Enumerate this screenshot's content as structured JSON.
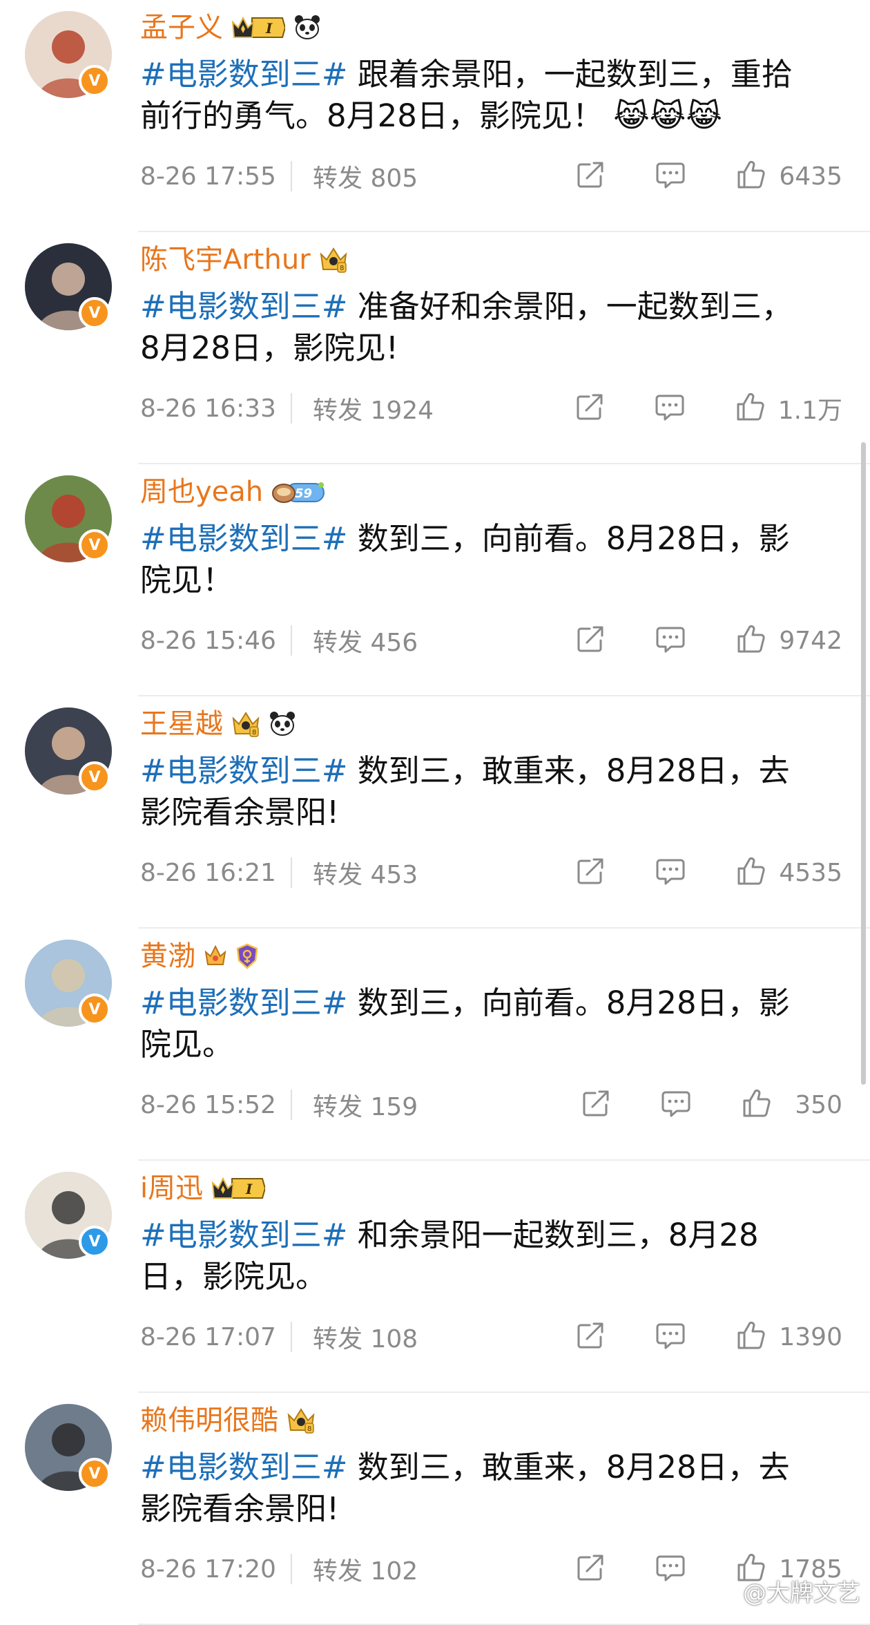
{
  "posts": [
    {
      "name": "孟子义",
      "verify": "orange",
      "medals": [
        "crown-level-1-badge",
        "panda-icon"
      ],
      "hashtag": "#电影数到三#",
      "text_line1": " 跟着余景阳，一起数到三，重拾",
      "text_line2": "前行的勇气。8月28日，影院见！",
      "emoji": "😹😹😹",
      "time": "8-26 17:55",
      "repost": "转发 805",
      "likes": "6435",
      "avatar_bg": "#e9d9cd",
      "avatar_fg": "#b5442c"
    },
    {
      "name": "陈飞宇Arthur",
      "verify": "orange",
      "medals": [
        "crown-gold-badge"
      ],
      "hashtag": "#电影数到三#",
      "text_line1": " 准备好和余景阳，一起数到三，",
      "text_line2": "8月28日，影院见!",
      "emoji": "",
      "time": "8-26 16:33",
      "repost": "转发 1924",
      "likes": "1.1万",
      "avatar_bg": "#2a2f3b",
      "avatar_fg": "#d8b8a4"
    },
    {
      "name": "周也yeah",
      "verify": "orange",
      "medals": [
        "level-59-badge"
      ],
      "hashtag": "#电影数到三#",
      "text_line1": " 数到三，向前看。8月28日，影",
      "text_line2": "院见！",
      "emoji": "",
      "time": "8-26 15:46",
      "repost": "转发 456",
      "likes": "9742",
      "avatar_bg": "#6d8a4a",
      "avatar_fg": "#c0392b"
    },
    {
      "name": "王星越",
      "verify": "orange",
      "medals": [
        "crown-gold-badge",
        "panda-icon"
      ],
      "hashtag": "#电影数到三#",
      "text_line1": " 数到三，敢重来，8月28日，去",
      "text_line2": "影院看余景阳!",
      "emoji": "",
      "time": "8-26 16:21",
      "repost": "转发 453",
      "likes": "4535",
      "avatar_bg": "#3d4250",
      "avatar_fg": "#d9b59a"
    },
    {
      "name": "黄渤",
      "verify": "orange",
      "medals": [
        "crown-small-badge",
        "shield-badge"
      ],
      "hashtag": "#电影数到三#",
      "text_line1": " 数到三，向前看。8月28日，影",
      "text_line2": "院见。",
      "emoji": "",
      "time": "8-26 15:52",
      "repost": "转发 159",
      "likes": "350",
      "avatar_bg": "#a9c4dc",
      "avatar_fg": "#d8c8a8"
    },
    {
      "name": "i周迅",
      "verify": "blue",
      "medals": [
        "crown-level-1-badge"
      ],
      "hashtag": "#电影数到三#",
      "text_line1": " 和余景阳一起数到三，8月28",
      "text_line2": "日，影院见。",
      "emoji": "",
      "time": "8-26 17:07",
      "repost": "转发 108",
      "likes": "1390",
      "avatar_bg": "#e8e2d8",
      "avatar_fg": "#3a3a3a"
    },
    {
      "name": "赖伟明很酷",
      "verify": "orange",
      "medals": [
        "crown-gold-badge"
      ],
      "hashtag": "#电影数到三#",
      "text_line1": " 数到三，敢重来，8月28日，去",
      "text_line2": "影院看余景阳!",
      "emoji": "",
      "time": "8-26 17:20",
      "repost": "转发 102",
      "likes": "1785",
      "avatar_bg": "#6e7c8c",
      "avatar_fg": "#2b2b2b"
    }
  ],
  "watermark": "@大牌文艺",
  "colors": {
    "name": "#e8761c",
    "hashtag": "#1e6fb8",
    "meta": "#8a8a8a",
    "verify_orange": "#f7941d",
    "verify_blue": "#2d9ae8"
  }
}
